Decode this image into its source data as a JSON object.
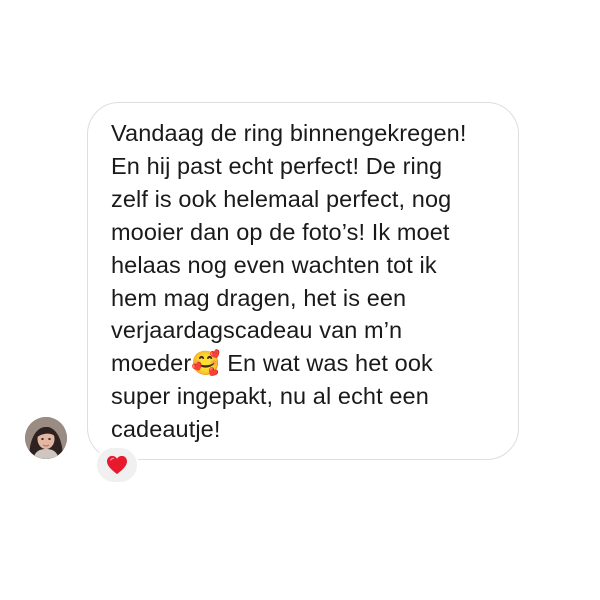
{
  "message": {
    "text": "Vandaag de ring binnengekregen!\nEn hij past echt perfect! De ring\nzelf is ook helemaal perfect, nog\nmooier dan op de foto’s! Ik moet\nhelaas nog even wachten tot ik\nhem mag dragen, het is een\nverjaardagscadeau van m’n\nmoeder🥰 En wat was het ook\nsuper ingepakt, nu al echt een\ncadeautje!"
  },
  "reaction": {
    "icon": "red-heart-icon",
    "color": "#e8192c"
  },
  "avatar": {
    "icon": "user-avatar-photo"
  }
}
